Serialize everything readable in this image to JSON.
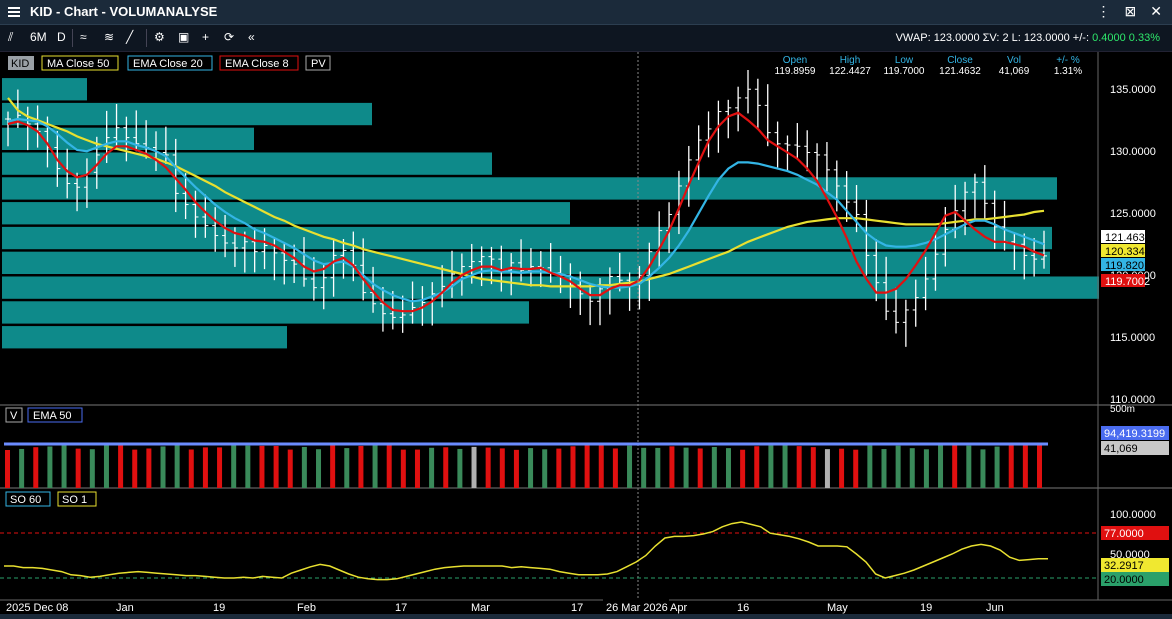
{
  "window": {
    "title": "KID - Chart - VOLUMANALYSE"
  },
  "toolbar": {
    "period": "6M",
    "interval": "D",
    "vwap_text": "VWAP: 123.0000  ΣV: 2  L: 123.0000  +/-:",
    "vwap_change": "0.4000",
    "vwap_pct": "0.33%"
  },
  "legend": {
    "symbol": "KID",
    "items": [
      {
        "label": "MA Close 50",
        "color": "#e8e030"
      },
      {
        "label": "EMA Close 20",
        "color": "#33b5e5"
      },
      {
        "label": "EMA Close 8",
        "color": "#e01010"
      },
      {
        "label": "PV",
        "color": "#e8e8e8"
      }
    ]
  },
  "ohlc": {
    "headers": [
      "Open",
      "High",
      "Low",
      "Close",
      "Vol",
      "+/- %"
    ],
    "values": [
      "119.8959",
      "122.4427",
      "119.7000",
      "121.4632",
      "41,069",
      "1.31%"
    ]
  },
  "price_axis": {
    "ticks": [
      "135.0000",
      "130.0000",
      "125.0000",
      "120.0000",
      "115.0000",
      "110.0000"
    ],
    "labels": [
      {
        "text": "121.4632",
        "bg": "#ffffff",
        "fg": "#000000"
      },
      {
        "text": "120.3347",
        "bg": "#f0e830",
        "fg": "#000000"
      },
      {
        "text": "119.8201",
        "bg": "#33b5e5",
        "fg": "#000000"
      },
      {
        "text": "119.7002",
        "bg": "#e01010",
        "fg": "#ffffff"
      }
    ]
  },
  "volume_panel": {
    "tag": "V",
    "ema_label": "EMA  50",
    "scale_label": "500m",
    "ema_value": "94,419.3199",
    "vol_value": "41,069"
  },
  "so_panel": {
    "labels": [
      "SO  60",
      "SO  1"
    ],
    "ticks": [
      "100.0000",
      "50.0000"
    ],
    "value_labels": [
      {
        "text": "77.0000",
        "bg": "#e01010",
        "fg": "#ffffff"
      },
      {
        "text": "32.2917",
        "bg": "#f0e830",
        "fg": "#000000"
      },
      {
        "text": "20.0000",
        "bg": "#2aa06a",
        "fg": "#000000"
      }
    ]
  },
  "x_axis": {
    "labels": [
      "2025 Dec 08",
      "Jan",
      "19",
      "Feb",
      "17",
      "Mar",
      "17",
      "26 Mar 2026",
      "Apr",
      "16",
      "May",
      "19",
      "Jun"
    ]
  },
  "chart_data": {
    "type": "candlestick",
    "ylim": [
      110,
      136
    ],
    "volume_profile_bands": [
      {
        "low": 134.0,
        "high": 135.8,
        "volume": 85
      },
      {
        "low": 132.0,
        "high": 133.8,
        "volume": 370
      },
      {
        "low": 130.0,
        "high": 131.8,
        "volume": 252
      },
      {
        "low": 128.0,
        "high": 129.8,
        "volume": 490
      },
      {
        "low": 126.0,
        "high": 127.8,
        "volume": 1055
      },
      {
        "low": 124.0,
        "high": 125.8,
        "volume": 568
      },
      {
        "low": 122.0,
        "high": 123.8,
        "volume": 1050
      },
      {
        "low": 120.0,
        "high": 121.8,
        "volume": 1048
      },
      {
        "low": 118.0,
        "high": 119.8,
        "volume": 1097
      },
      {
        "low": 116.0,
        "high": 117.8,
        "volume": 527
      },
      {
        "low": 114.0,
        "high": 115.8,
        "volume": 285
      }
    ],
    "close": [
      132.5,
      132.8,
      132.1,
      131.5,
      130.2,
      128.5,
      127.3,
      127.0,
      128.2,
      129.6,
      131.0,
      131.8,
      131.0,
      130.5,
      130.2,
      129.8,
      129.6,
      126.5,
      125.6,
      124.6,
      123.9,
      123.1,
      122.5,
      122.1,
      122.6,
      121.8,
      122.3,
      121.7,
      121.1,
      120.8,
      119.6,
      118.9,
      119.7,
      121.5,
      121.9,
      120.7,
      118.5,
      117.6,
      116.8,
      116.5,
      116.7,
      117.3,
      117.7,
      118.4,
      119.0,
      120.0,
      120.6,
      121.0,
      121.4,
      121.2,
      120.3,
      120.9,
      120.3,
      120.6,
      120.5,
      120.1,
      119.9,
      119.1,
      118.4,
      117.8,
      118.8,
      119.8,
      119.5,
      119.2,
      119.9,
      121.8,
      123.5,
      124.8,
      127.1,
      129.2,
      130.8,
      131.7,
      133.1,
      133.4,
      134.2,
      134.9,
      133.6,
      131.4,
      130.5,
      130.4,
      130.3,
      129.8,
      129.6,
      128.4,
      127.1,
      125.8,
      124.8,
      121.5,
      119.3,
      117.0,
      116.1,
      117.1,
      118.1,
      119.6,
      121.6,
      123.6,
      125.1,
      126.6,
      127.4,
      125.7,
      123.8,
      122.6,
      122.4,
      121.5,
      121.2,
      121.46
    ],
    "ma50": [
      134.2,
      133.2,
      132.7,
      132.4,
      132.1,
      131.8,
      131.5,
      131.1,
      130.8,
      130.5,
      130.3,
      130.1,
      129.9,
      129.7,
      129.5,
      129.3,
      129.0,
      128.7,
      128.3,
      127.9,
      127.5,
      127.1,
      126.6,
      126.2,
      125.8,
      125.4,
      125.0,
      124.6,
      124.3,
      123.9,
      123.6,
      123.3,
      123.0,
      122.8,
      122.5,
      122.3,
      122.0,
      121.8,
      121.6,
      121.4,
      121.2,
      121.0,
      120.8,
      120.6,
      120.4,
      120.2,
      120.0,
      119.8,
      119.6,
      119.5,
      119.4,
      119.3,
      119.2,
      119.1,
      119.1,
      119.0,
      119.0,
      119.0,
      119.0,
      119.0,
      119.1,
      119.1,
      119.2,
      119.3,
      119.4,
      119.6,
      119.8,
      120.0,
      120.3,
      120.6,
      120.9,
      121.2,
      121.5,
      121.8,
      122.2,
      122.6,
      122.9,
      123.2,
      123.5,
      123.8,
      124.0,
      124.2,
      124.3,
      124.4,
      124.5,
      124.5,
      124.5,
      124.4,
      124.3,
      124.2,
      124.1,
      124.0,
      124.0,
      124.0,
      124.0,
      124.1,
      124.2,
      124.3,
      124.4,
      124.4,
      124.5,
      124.6,
      124.7,
      124.8,
      125.0,
      125.1
    ],
    "ema20": [
      132.3,
      132.5,
      132.4,
      132.3,
      131.9,
      131.3,
      130.6,
      130.0,
      129.9,
      130.2,
      130.5,
      130.7,
      130.7,
      130.4,
      130.2,
      129.9,
      129.5,
      128.6,
      127.8,
      127.0,
      126.3,
      125.6,
      125.0,
      124.5,
      124.1,
      123.6,
      123.3,
      122.9,
      122.5,
      122.1,
      121.6,
      121.1,
      120.8,
      120.9,
      121.0,
      120.6,
      119.9,
      119.2,
      118.7,
      118.3,
      118.0,
      117.8,
      117.9,
      118.2,
      118.5,
      119.0,
      119.6,
      119.9,
      120.2,
      120.3,
      120.2,
      120.2,
      120.1,
      120.2,
      120.2,
      120.1,
      120.0,
      119.8,
      119.5,
      119.2,
      119.0,
      118.9,
      118.9,
      119.0,
      119.2,
      119.8,
      120.5,
      121.3,
      122.3,
      123.5,
      124.9,
      126.3,
      127.6,
      128.5,
      129.0,
      129.0,
      128.9,
      128.7,
      128.5,
      128.3,
      128.0,
      127.6,
      127.2,
      126.6,
      126.0,
      125.1,
      124.2,
      123.3,
      122.7,
      122.3,
      122.2,
      122.2,
      122.3,
      122.5,
      122.8,
      123.2,
      123.6,
      124.0,
      124.3,
      124.3,
      124.0,
      123.6,
      123.3,
      123.0,
      122.7,
      122.4
    ],
    "ema8": [
      132.1,
      132.3,
      132.0,
      131.5,
      130.5,
      129.2,
      128.3,
      127.8,
      128.0,
      128.8,
      129.7,
      130.3,
      130.3,
      130.0,
      129.7,
      129.2,
      128.6,
      127.7,
      126.8,
      125.8,
      125.0,
      124.3,
      123.7,
      123.3,
      123.1,
      122.7,
      122.6,
      122.3,
      121.8,
      121.3,
      120.6,
      120.2,
      120.4,
      121.0,
      121.3,
      120.7,
      119.6,
      118.6,
      117.7,
      117.1,
      117.0,
      117.0,
      117.3,
      117.8,
      118.5,
      119.3,
      119.9,
      120.3,
      120.6,
      120.6,
      120.3,
      120.5,
      120.4,
      120.4,
      120.5,
      120.1,
      119.8,
      119.4,
      118.8,
      118.3,
      118.3,
      118.8,
      119.1,
      119.1,
      119.5,
      120.6,
      122.0,
      123.5,
      125.3,
      127.2,
      129.0,
      130.7,
      131.9,
      132.7,
      133.0,
      132.4,
      131.7,
      130.8,
      130.3,
      129.8,
      129.3,
      128.5,
      127.5,
      126.1,
      124.6,
      122.9,
      121.0,
      119.6,
      118.5,
      118.5,
      118.8,
      119.6,
      120.7,
      121.9,
      123.3,
      124.7,
      125.0,
      124.3,
      123.6,
      123.0,
      122.6,
      122.6,
      122.4,
      122.2,
      121.8,
      121.5
    ],
    "volume_bar_count": 74,
    "volume_ema50": 94419.3199,
    "so_60": 77.0,
    "so_1": [
      35,
      35,
      33,
      33,
      32,
      30,
      28,
      24,
      23,
      21,
      22,
      24,
      26,
      27,
      28,
      27,
      26,
      25,
      24,
      23,
      23,
      22,
      21,
      20,
      20,
      21,
      20,
      22,
      21,
      20,
      26,
      30,
      34,
      37,
      35,
      30,
      25,
      21,
      19,
      18,
      18,
      19,
      22,
      25,
      28,
      31,
      33,
      34,
      35,
      35,
      35,
      35,
      35,
      33,
      34,
      33,
      32,
      31,
      28,
      26,
      24,
      24,
      24,
      25,
      28,
      34,
      40,
      48,
      60,
      70,
      72,
      72,
      73,
      75,
      78,
      84,
      88,
      90,
      87,
      84,
      76,
      74,
      72,
      69,
      65,
      60,
      60,
      60,
      59,
      50,
      40,
      25,
      20,
      23,
      26,
      30,
      35,
      40,
      45,
      50,
      56,
      60,
      62,
      60,
      55,
      46,
      42,
      43,
      44,
      44
    ]
  }
}
